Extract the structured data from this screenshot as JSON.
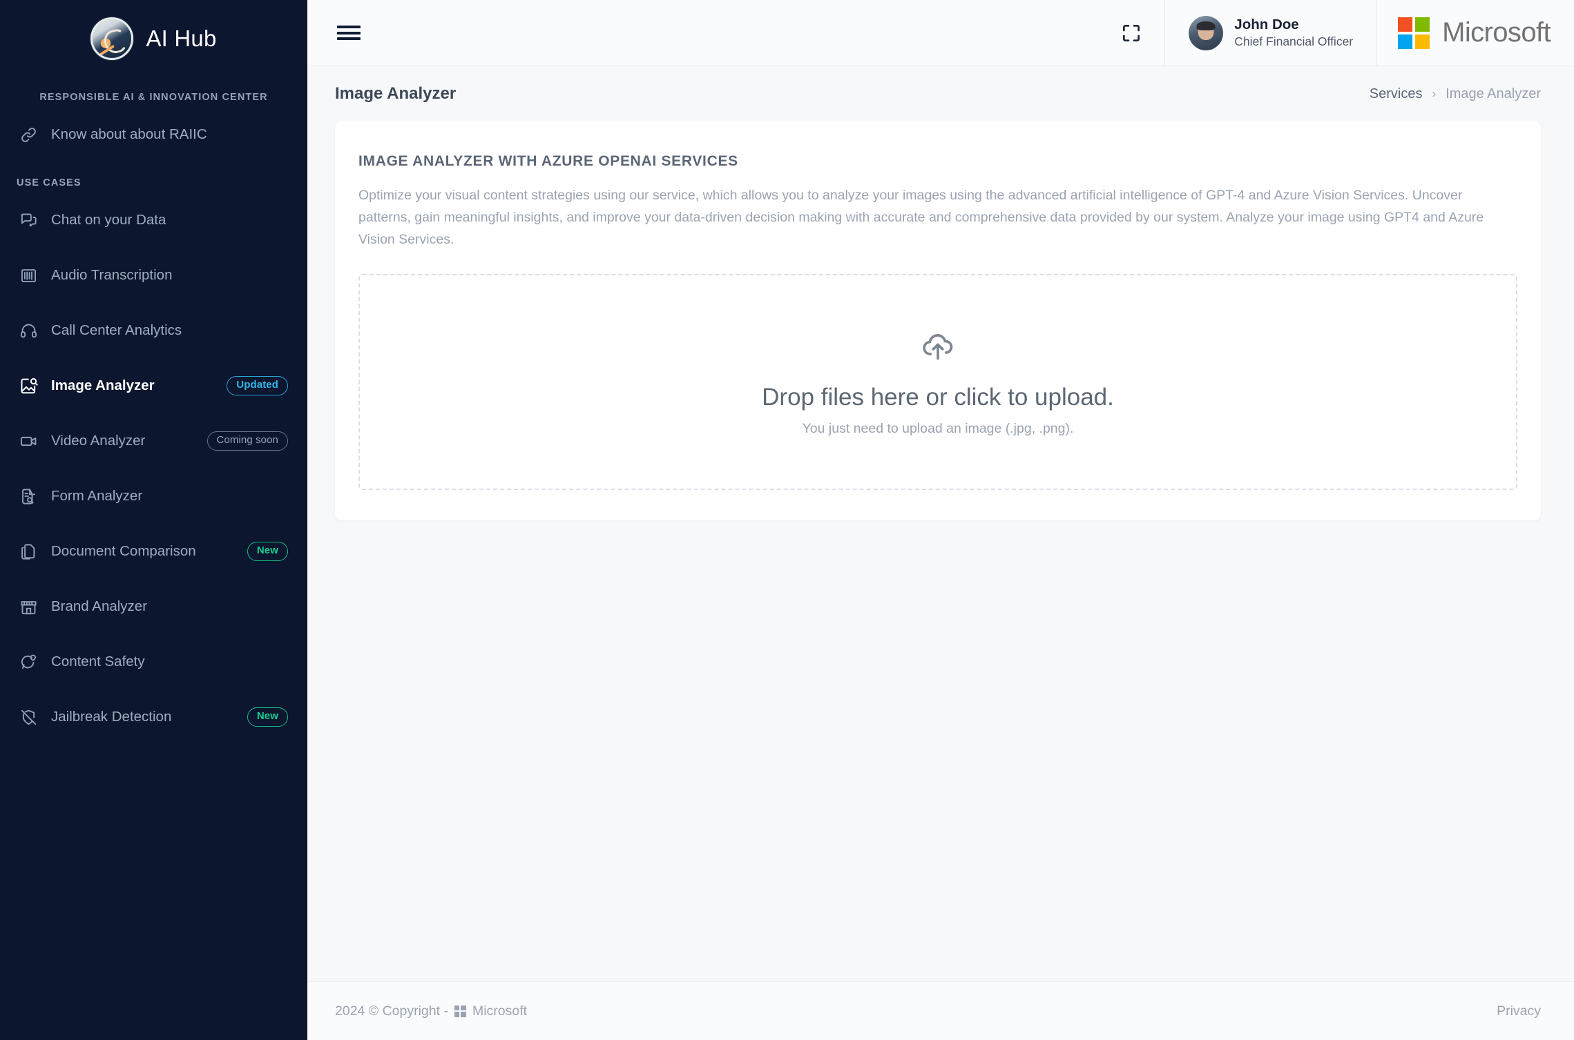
{
  "sidebar": {
    "brand_name": "AI Hub",
    "brand_logo_icon": "ai-brain-circuit-logo",
    "center_section_label": "RESPONSIBLE AI & INNOVATION CENTER",
    "know_link": {
      "label": "Know about about RAIIC",
      "icon": "link-icon"
    },
    "use_cases_label": "USE CASES",
    "items": [
      {
        "label": "Chat on your Data",
        "icon": "chat-bubbles-icon",
        "badge": null,
        "badge_type": null,
        "active": false
      },
      {
        "label": "Audio Transcription",
        "icon": "audio-waveform-icon",
        "badge": null,
        "badge_type": null,
        "active": false
      },
      {
        "label": "Call Center Analytics",
        "icon": "headset-icon",
        "badge": null,
        "badge_type": null,
        "active": false
      },
      {
        "label": "Image Analyzer",
        "icon": "image-search-icon",
        "badge": "Updated",
        "badge_type": "updated",
        "active": true
      },
      {
        "label": "Video Analyzer",
        "icon": "video-camera-icon",
        "badge": "Coming soon",
        "badge_type": "coming",
        "active": false
      },
      {
        "label": "Form Analyzer",
        "icon": "document-search-icon",
        "badge": null,
        "badge_type": null,
        "active": false
      },
      {
        "label": "Document Comparison",
        "icon": "copy-documents-icon",
        "badge": "New",
        "badge_type": "new",
        "active": false
      },
      {
        "label": "Brand Analyzer",
        "icon": "storefront-icon",
        "badge": null,
        "badge_type": null,
        "active": false
      },
      {
        "label": "Content Safety",
        "icon": "shield-chat-icon",
        "badge": null,
        "badge_type": null,
        "active": false
      },
      {
        "label": "Jailbreak Detection",
        "icon": "shield-off-icon",
        "badge": "New",
        "badge_type": "new",
        "active": false
      }
    ]
  },
  "topbar": {
    "menu_icon": "hamburger-menu-icon",
    "fullscreen_icon": "fullscreen-expand-icon",
    "user": {
      "name": "John Doe",
      "role": "Chief Financial Officer",
      "avatar_icon": "user-avatar"
    },
    "microsoft": {
      "word": "Microsoft",
      "logo_icon": "microsoft-logo"
    }
  },
  "page": {
    "title": "Image Analyzer",
    "breadcrumb": {
      "parent": "Services",
      "separator": "›",
      "current": "Image Analyzer"
    }
  },
  "card": {
    "title": "IMAGE ANALYZER WITH AZURE OPENAI SERVICES",
    "description": "Optimize your visual content strategies using our service, which allows you to analyze your images using the advanced artificial intelligence of GPT-4 and Azure Vision Services. Uncover patterns, gain meaningful insights, and improve your data-driven decision making with accurate and comprehensive data provided by our system. Analyze your image using GPT4 and Azure Vision Services."
  },
  "dropzone": {
    "icon": "cloud-upload-icon",
    "title": "Drop files here or click to upload.",
    "subtitle": "You just need to upload an image (.jpg, .png)."
  },
  "footer": {
    "copyright_text": "2024 © Copyright -",
    "company": "Microsoft",
    "logo_icon": "microsoft-logo-small",
    "privacy_label": "Privacy"
  },
  "colors": {
    "sidebar_bg": "#0c162e",
    "accent_updated": "#31b6e8",
    "accent_new": "#18cf92",
    "ms_red": "#F25022",
    "ms_green": "#7FBA00",
    "ms_blue": "#00A4EF",
    "ms_yellow": "#FFB900"
  }
}
